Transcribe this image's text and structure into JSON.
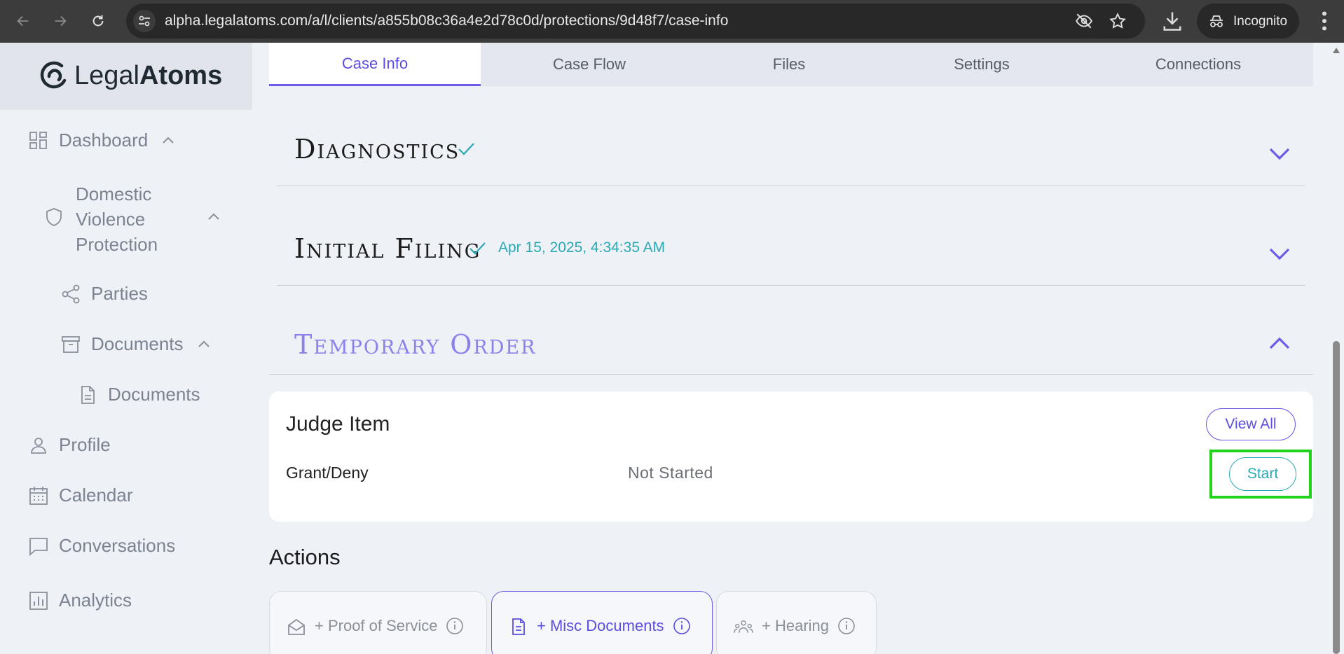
{
  "browser": {
    "url": "alpha.legalatoms.com/a/l/clients/a855b08c36a4e2d78c0d/protections/9d48f7/case-info",
    "profile_label": "Incognito"
  },
  "brand": {
    "name_light": "Legal",
    "name_bold": "Atoms"
  },
  "sidebar": {
    "dashboard": "Dashboard",
    "domestic_violence_protection": "Domestic Violence Protection",
    "parties": "Parties",
    "documents_group": "Documents",
    "documents_item": "Documents",
    "profile": "Profile",
    "calendar": "Calendar",
    "conversations": "Conversations",
    "analytics": "Analytics"
  },
  "tabs": [
    {
      "label": "Case Info",
      "active": true
    },
    {
      "label": "Case Flow"
    },
    {
      "label": "Files"
    },
    {
      "label": "Settings"
    },
    {
      "label": "Connections"
    }
  ],
  "sections": {
    "diagnostics": {
      "title": "Diagnostics",
      "completed": true
    },
    "initial_filing": {
      "title": "Initial Filing",
      "completed": true,
      "timestamp": "Apr 15, 2025, 4:34:35 AM"
    },
    "temporary_order": {
      "title": "Temporary Order",
      "expanded": true
    }
  },
  "judge_item": {
    "title": "Judge Item",
    "view_all_label": "View All",
    "row": {
      "name": "Grant/Deny",
      "status": "Not Started",
      "action_label": "Start"
    }
  },
  "actions": {
    "title": "Actions",
    "items": [
      {
        "label": "+ Proof of Service"
      },
      {
        "label": "+ Misc Documents",
        "selected": true
      },
      {
        "label": "+ Hearing"
      }
    ]
  },
  "colors": {
    "accent": "#6c5ce7",
    "teal": "#2aa9b3",
    "highlight": "#22d31c"
  }
}
